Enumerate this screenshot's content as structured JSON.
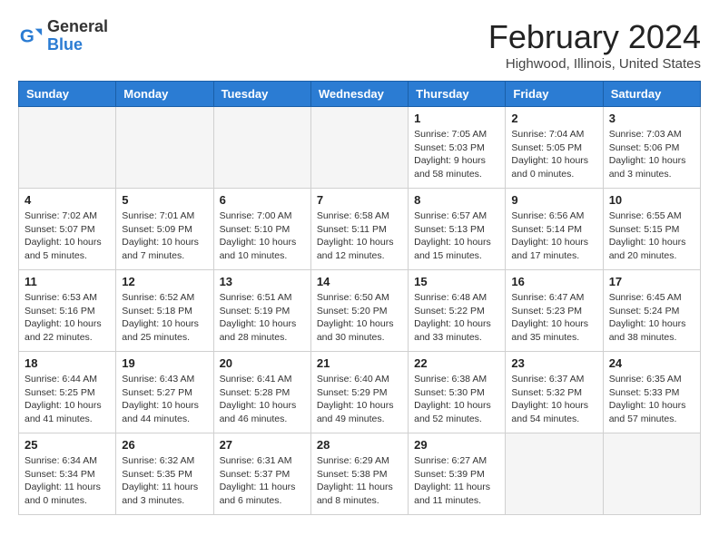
{
  "header": {
    "logo_line1": "General",
    "logo_line2": "Blue",
    "main_title": "February 2024",
    "subtitle": "Highwood, Illinois, United States"
  },
  "days_of_week": [
    "Sunday",
    "Monday",
    "Tuesday",
    "Wednesday",
    "Thursday",
    "Friday",
    "Saturday"
  ],
  "weeks": [
    [
      {
        "day": "",
        "info": ""
      },
      {
        "day": "",
        "info": ""
      },
      {
        "day": "",
        "info": ""
      },
      {
        "day": "",
        "info": ""
      },
      {
        "day": "1",
        "info": "Sunrise: 7:05 AM\nSunset: 5:03 PM\nDaylight: 9 hours\nand 58 minutes."
      },
      {
        "day": "2",
        "info": "Sunrise: 7:04 AM\nSunset: 5:05 PM\nDaylight: 10 hours\nand 0 minutes."
      },
      {
        "day": "3",
        "info": "Sunrise: 7:03 AM\nSunset: 5:06 PM\nDaylight: 10 hours\nand 3 minutes."
      }
    ],
    [
      {
        "day": "4",
        "info": "Sunrise: 7:02 AM\nSunset: 5:07 PM\nDaylight: 10 hours\nand 5 minutes."
      },
      {
        "day": "5",
        "info": "Sunrise: 7:01 AM\nSunset: 5:09 PM\nDaylight: 10 hours\nand 7 minutes."
      },
      {
        "day": "6",
        "info": "Sunrise: 7:00 AM\nSunset: 5:10 PM\nDaylight: 10 hours\nand 10 minutes."
      },
      {
        "day": "7",
        "info": "Sunrise: 6:58 AM\nSunset: 5:11 PM\nDaylight: 10 hours\nand 12 minutes."
      },
      {
        "day": "8",
        "info": "Sunrise: 6:57 AM\nSunset: 5:13 PM\nDaylight: 10 hours\nand 15 minutes."
      },
      {
        "day": "9",
        "info": "Sunrise: 6:56 AM\nSunset: 5:14 PM\nDaylight: 10 hours\nand 17 minutes."
      },
      {
        "day": "10",
        "info": "Sunrise: 6:55 AM\nSunset: 5:15 PM\nDaylight: 10 hours\nand 20 minutes."
      }
    ],
    [
      {
        "day": "11",
        "info": "Sunrise: 6:53 AM\nSunset: 5:16 PM\nDaylight: 10 hours\nand 22 minutes."
      },
      {
        "day": "12",
        "info": "Sunrise: 6:52 AM\nSunset: 5:18 PM\nDaylight: 10 hours\nand 25 minutes."
      },
      {
        "day": "13",
        "info": "Sunrise: 6:51 AM\nSunset: 5:19 PM\nDaylight: 10 hours\nand 28 minutes."
      },
      {
        "day": "14",
        "info": "Sunrise: 6:50 AM\nSunset: 5:20 PM\nDaylight: 10 hours\nand 30 minutes."
      },
      {
        "day": "15",
        "info": "Sunrise: 6:48 AM\nSunset: 5:22 PM\nDaylight: 10 hours\nand 33 minutes."
      },
      {
        "day": "16",
        "info": "Sunrise: 6:47 AM\nSunset: 5:23 PM\nDaylight: 10 hours\nand 35 minutes."
      },
      {
        "day": "17",
        "info": "Sunrise: 6:45 AM\nSunset: 5:24 PM\nDaylight: 10 hours\nand 38 minutes."
      }
    ],
    [
      {
        "day": "18",
        "info": "Sunrise: 6:44 AM\nSunset: 5:25 PM\nDaylight: 10 hours\nand 41 minutes."
      },
      {
        "day": "19",
        "info": "Sunrise: 6:43 AM\nSunset: 5:27 PM\nDaylight: 10 hours\nand 44 minutes."
      },
      {
        "day": "20",
        "info": "Sunrise: 6:41 AM\nSunset: 5:28 PM\nDaylight: 10 hours\nand 46 minutes."
      },
      {
        "day": "21",
        "info": "Sunrise: 6:40 AM\nSunset: 5:29 PM\nDaylight: 10 hours\nand 49 minutes."
      },
      {
        "day": "22",
        "info": "Sunrise: 6:38 AM\nSunset: 5:30 PM\nDaylight: 10 hours\nand 52 minutes."
      },
      {
        "day": "23",
        "info": "Sunrise: 6:37 AM\nSunset: 5:32 PM\nDaylight: 10 hours\nand 54 minutes."
      },
      {
        "day": "24",
        "info": "Sunrise: 6:35 AM\nSunset: 5:33 PM\nDaylight: 10 hours\nand 57 minutes."
      }
    ],
    [
      {
        "day": "25",
        "info": "Sunrise: 6:34 AM\nSunset: 5:34 PM\nDaylight: 11 hours\nand 0 minutes."
      },
      {
        "day": "26",
        "info": "Sunrise: 6:32 AM\nSunset: 5:35 PM\nDaylight: 11 hours\nand 3 minutes."
      },
      {
        "day": "27",
        "info": "Sunrise: 6:31 AM\nSunset: 5:37 PM\nDaylight: 11 hours\nand 6 minutes."
      },
      {
        "day": "28",
        "info": "Sunrise: 6:29 AM\nSunset: 5:38 PM\nDaylight: 11 hours\nand 8 minutes."
      },
      {
        "day": "29",
        "info": "Sunrise: 6:27 AM\nSunset: 5:39 PM\nDaylight: 11 hours\nand 11 minutes."
      },
      {
        "day": "",
        "info": ""
      },
      {
        "day": "",
        "info": ""
      }
    ]
  ]
}
